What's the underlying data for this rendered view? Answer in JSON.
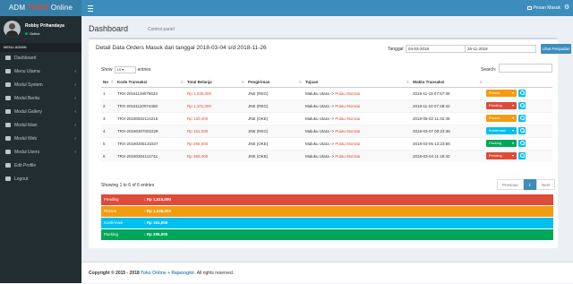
{
  "brand": {
    "part1": "ADM ",
    "part2": "TOKO",
    "part3": " Online"
  },
  "topbar": {
    "messages_label": "Pesan Masuk"
  },
  "user": {
    "name": "Robby Prihandaya",
    "status": "Online"
  },
  "sidebar": {
    "header": "MENU ADMIN",
    "items": [
      {
        "label": "Dashboard",
        "icon": "dashboard-icon",
        "arrow": ""
      },
      {
        "label": "Menu Utama",
        "icon": "th-icon",
        "arrow": "‹"
      },
      {
        "label": "Modul System",
        "icon": "gear-icon",
        "arrow": "‹"
      },
      {
        "label": "Modul Berita",
        "icon": "pencil-icon",
        "arrow": "‹"
      },
      {
        "label": "Modul Gallery",
        "icon": "camera-icon",
        "arrow": "‹"
      },
      {
        "label": "Modul Iklan",
        "icon": "bullhorn-icon",
        "arrow": "‹"
      },
      {
        "label": "Modul Web",
        "icon": "globe-icon",
        "arrow": "‹"
      },
      {
        "label": "Modul Users",
        "icon": "users-icon",
        "arrow": "‹"
      },
      {
        "label": "Edit Profile",
        "icon": "user-icon",
        "arrow": ""
      },
      {
        "label": "Logout",
        "icon": "power-icon",
        "arrow": ""
      }
    ]
  },
  "page": {
    "title": "Dashboard",
    "subtitle": "Control panel"
  },
  "box": {
    "title": "Detail Data Orders Masuk dari tanggal 2018-03-04 s/d 2018-11-26",
    "tanggal_label": "Tanggal",
    "date_from": "04-03-2018",
    "date_to": "26-11-2018",
    "btn_lihat": "Lihat Penjualan",
    "show_label": "Show",
    "show_value": "10",
    "entries_label": "entries",
    "search_label": "Search:"
  },
  "table": {
    "columns": [
      "No",
      "Kode Transaksi",
      "Total Belanja",
      "Pengiriman",
      "Tujuan",
      "Waktu Transaksi"
    ],
    "rows": [
      {
        "no": "1",
        "kode": "TRX-20181119075633",
        "total": "Rp 1,035,000",
        "kirim": "JNE (REG)",
        "tujuan_a": "Maluku Utara -> ",
        "tujuan_b": "Pulau Morotai",
        "waktu": "2018-11-19 07:57:38",
        "status": "Proses",
        "status_color": "#f39c12"
      },
      {
        "no": "2",
        "kode": "TRX-20181110074458",
        "total": "Rp 1,101,000",
        "kirim": "JNE (REG)",
        "tujuan_a": "Maluku Utara -> ",
        "tujuan_b": "Pulau Morotai",
        "waktu": "2018-11-10 07:48:42",
        "status": "Pending",
        "status_color": "#dd4b39"
      },
      {
        "no": "3",
        "kode": "TRX-20180502114216",
        "total": "Rp 130,000",
        "kirim": "JNE (OKE)",
        "tujuan_a": "Maluku Utara -> ",
        "tujuan_b": "Pulau Morotai",
        "waktu": "2018-05-02 11:42:45",
        "status": "Proses",
        "status_color": "#f39c12"
      },
      {
        "no": "4",
        "kode": "TRX-20180307002229",
        "total": "Rp 151,000",
        "kirim": "JNE (REG)",
        "tujuan_a": "Maluku Utara -> ",
        "tujuan_b": "Pulau Morotai",
        "waktu": "2018-03-07 00:22:36",
        "status": "Konfirmasi",
        "status_color": "#00c0ef"
      },
      {
        "no": "5",
        "kode": "TRX-20180305133337",
        "total": "Rp 295,000",
        "kirim": "JNE (OKE)",
        "tujuan_a": "Maluku Utara -> ",
        "tujuan_b": "Pulau Morotai",
        "waktu": "2018-03-05 13:23:56",
        "status": "Packing",
        "status_color": "#00a65a"
      },
      {
        "no": "6",
        "kode": "TRX-20180304111742",
        "total": "Rp 369,000",
        "kirim": "JNE (OKE)",
        "tujuan_a": "Maluku Utara -> ",
        "tujuan_b": "Pulau Morotai",
        "waktu": "2018-03-04 11:19:32",
        "status": "Pending",
        "status_color": "#dd4b39"
      }
    ]
  },
  "showing": "Showing 1 to 6 of 6 entries",
  "pager": {
    "prev": "Previous",
    "page": "1",
    "next": "Next"
  },
  "summary": [
    {
      "label": "Pending",
      "value": ": Rp 1,515,000",
      "color": "#dd4b39"
    },
    {
      "label": "Proses",
      "value": ": Rp 1,048,000",
      "color": "#f39c12"
    },
    {
      "label": "Konfirmasi",
      "value": ": Rp 151,000",
      "color": "#00c0ef"
    },
    {
      "label": "Packing",
      "value": ": Rp 295,000",
      "color": "#00a65a"
    }
  ],
  "footer": {
    "prefix": "Copyright © 2015 - 2018 ",
    "link": "Toko Online + Rajaongkir",
    "suffix": ". All rights reserved."
  }
}
